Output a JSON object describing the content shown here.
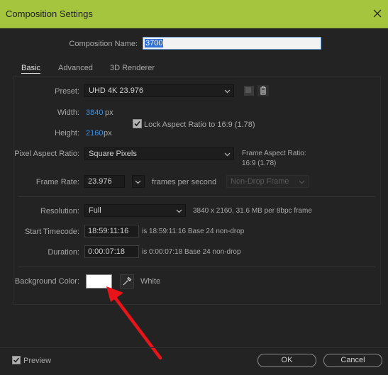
{
  "window": {
    "title": "Composition Settings"
  },
  "composition_name": {
    "label": "Composition Name:",
    "value": "3700"
  },
  "tabs": [
    {
      "label": "Basic",
      "active": true
    },
    {
      "label": "Advanced",
      "active": false
    },
    {
      "label": "3D Renderer",
      "active": false
    }
  ],
  "preset": {
    "label": "Preset:",
    "value": "UHD 4K 23.976"
  },
  "width": {
    "label": "Width:",
    "value": "3840",
    "unit": "px"
  },
  "height": {
    "label": "Height:",
    "value": "2160",
    "unit": "px"
  },
  "lock_aspect": {
    "label": "Lock Aspect Ratio to 16:9 (1.78)",
    "checked": true
  },
  "pixel_aspect": {
    "label": "Pixel Aspect Ratio:",
    "value": "Square Pixels"
  },
  "frame_aspect": {
    "line1": "Frame Aspect Ratio:",
    "line2": "16:9 (1.78)"
  },
  "frame_rate": {
    "label": "Frame Rate:",
    "value": "23.976",
    "unit": "frames per second",
    "drop_frame": "Non-Drop Frame"
  },
  "resolution": {
    "label": "Resolution:",
    "value": "Full",
    "info": "3840 x 2160, 31.6 MB per 8bpc frame"
  },
  "start_timecode": {
    "label": "Start Timecode:",
    "value": "18:59:11:16",
    "info": "is 18:59:11:16  Base 24  non-drop"
  },
  "duration": {
    "label": "Duration:",
    "value": "0:00:07:18",
    "info": "is 0:00:07:18  Base 24  non-drop"
  },
  "background_color": {
    "label": "Background Color:",
    "name": "White",
    "swatch": "#ffffff"
  },
  "footer": {
    "preview_label": "Preview",
    "preview_checked": true,
    "ok_label": "OK",
    "cancel_label": "Cancel"
  },
  "colors": {
    "titlebar": "#a6c53f",
    "accent_blue": "#3d8fe0",
    "annotation_arrow": "#e8141a"
  },
  "icons": [
    "close-icon",
    "chevron-down-icon",
    "save-preset-icon",
    "trash-icon",
    "checkbox-icon",
    "eyedropper-icon"
  ]
}
